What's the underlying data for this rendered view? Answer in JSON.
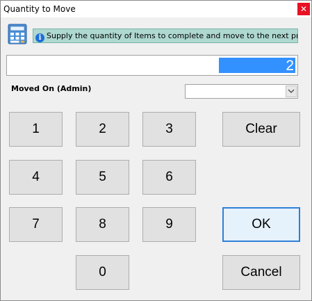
{
  "window": {
    "title": "Quantity to Move",
    "close_glyph": "✕"
  },
  "info": {
    "icon": "info-icon",
    "icon_glyph": "i",
    "message": "Supply the quantity of Items to complete and move to the next process."
  },
  "quantity": {
    "value": "2"
  },
  "moved_on": {
    "label": "Moved On (Admin)",
    "selected": ""
  },
  "keypad": {
    "keys": [
      "1",
      "2",
      "3",
      "4",
      "5",
      "6",
      "7",
      "8",
      "9",
      "0"
    ]
  },
  "actions": {
    "clear": "Clear",
    "ok": "OK",
    "cancel": "Cancel"
  },
  "colors": {
    "info_banner_bg": "#aed8d0",
    "selection": "#3390ff",
    "ok_border": "#2f7fd8",
    "close_bg": "#e81123"
  }
}
